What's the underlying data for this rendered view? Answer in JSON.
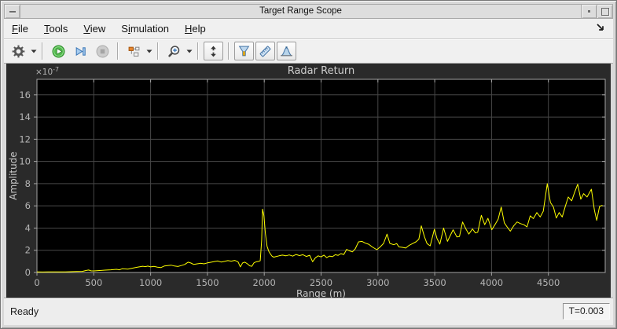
{
  "window": {
    "title": "Target Range Scope",
    "controls": [
      "window-menu",
      "minimize",
      "maximize"
    ]
  },
  "menubar": {
    "items": [
      {
        "label": "File",
        "underline": 0
      },
      {
        "label": "Tools",
        "underline": 0
      },
      {
        "label": "View",
        "underline": 0
      },
      {
        "label": "Simulation",
        "underline": 1
      },
      {
        "label": "Help",
        "underline": 0
      }
    ],
    "dock_icon": "arrow-southeast"
  },
  "toolbar": {
    "buttons": [
      {
        "name": "settings",
        "icon": "gear-icon",
        "dropdown": true,
        "enabled": true
      },
      {
        "name": "run",
        "icon": "run-icon",
        "enabled": true
      },
      {
        "name": "step-forward",
        "icon": "step-forward-icon",
        "enabled": true
      },
      {
        "name": "stop",
        "icon": "stop-icon",
        "enabled": false
      },
      {
        "name": "highlight-simulink-block",
        "icon": "simulink-blocks-icon",
        "dropdown": true,
        "enabled": true
      },
      {
        "name": "zoom",
        "icon": "zoom-in-icon",
        "dropdown": true,
        "enabled": true
      },
      {
        "name": "scale-axes",
        "icon": "scale-y-axis-icon",
        "bordered": true,
        "enabled": true
      },
      {
        "name": "trigger",
        "icon": "trigger-icon",
        "bordered": true,
        "enabled": true
      },
      {
        "name": "cursor-measurements",
        "icon": "ruler-icon",
        "bordered": true,
        "enabled": true
      },
      {
        "name": "peak-finder",
        "icon": "peak-finder-icon",
        "bordered": true,
        "enabled": true
      }
    ]
  },
  "statusbar": {
    "status": "Ready",
    "time": "T=0.003"
  },
  "chart_data": {
    "type": "line",
    "title": "Radar Return",
    "xlabel": "Range (m)",
    "ylabel": "Amplitude",
    "y_scale": {
      "base": "×10",
      "exp": "-7"
    },
    "xlim": [
      0,
      5000
    ],
    "ylim": [
      0,
      17.4
    ],
    "xticks": [
      0,
      500,
      1000,
      1500,
      2000,
      2500,
      3000,
      3500,
      4000,
      4500
    ],
    "yticks": [
      0,
      2,
      4,
      6,
      8,
      10,
      12,
      14,
      16
    ],
    "grid": true,
    "legend": "none",
    "line_color": "#ffff00",
    "plot_bg": "#000000",
    "panel_bg": "#2a2a2a",
    "grid_color": "#474747",
    "tick_label_color": "#b4b4b4",
    "points": [
      [
        0,
        0.05
      ],
      [
        50,
        0.04
      ],
      [
        100,
        0.06
      ],
      [
        150,
        0.05
      ],
      [
        200,
        0.06
      ],
      [
        250,
        0.05
      ],
      [
        300,
        0.07
      ],
      [
        350,
        0.09
      ],
      [
        400,
        0.1
      ],
      [
        430,
        0.18
      ],
      [
        455,
        0.22
      ],
      [
        475,
        0.15
      ],
      [
        500,
        0.14
      ],
      [
        550,
        0.18
      ],
      [
        600,
        0.21
      ],
      [
        650,
        0.24
      ],
      [
        700,
        0.28
      ],
      [
        725,
        0.24
      ],
      [
        750,
        0.33
      ],
      [
        800,
        0.3
      ],
      [
        850,
        0.4
      ],
      [
        875,
        0.46
      ],
      [
        900,
        0.5
      ],
      [
        930,
        0.56
      ],
      [
        955,
        0.52
      ],
      [
        975,
        0.57
      ],
      [
        1000,
        0.5
      ],
      [
        1030,
        0.55
      ],
      [
        1060,
        0.48
      ],
      [
        1090,
        0.44
      ],
      [
        1120,
        0.58
      ],
      [
        1150,
        0.62
      ],
      [
        1180,
        0.66
      ],
      [
        1210,
        0.58
      ],
      [
        1240,
        0.54
      ],
      [
        1270,
        0.62
      ],
      [
        1300,
        0.72
      ],
      [
        1330,
        0.93
      ],
      [
        1355,
        0.85
      ],
      [
        1380,
        0.72
      ],
      [
        1410,
        0.78
      ],
      [
        1440,
        0.83
      ],
      [
        1470,
        0.78
      ],
      [
        1500,
        0.86
      ],
      [
        1530,
        0.92
      ],
      [
        1560,
        0.98
      ],
      [
        1590,
        1.03
      ],
      [
        1620,
        0.94
      ],
      [
        1650,
        1.0
      ],
      [
        1680,
        1.07
      ],
      [
        1710,
        1.02
      ],
      [
        1740,
        1.09
      ],
      [
        1770,
        0.95
      ],
      [
        1790,
        0.5
      ],
      [
        1810,
        0.86
      ],
      [
        1830,
        0.93
      ],
      [
        1852,
        0.78
      ],
      [
        1872,
        0.6
      ],
      [
        1890,
        0.55
      ],
      [
        1910,
        0.88
      ],
      [
        1930,
        0.96
      ],
      [
        1950,
        1.0
      ],
      [
        1965,
        1.06
      ],
      [
        1977,
        2.9
      ],
      [
        1985,
        5.7
      ],
      [
        1997,
        5.1
      ],
      [
        2010,
        3.55
      ],
      [
        2025,
        2.35
      ],
      [
        2040,
        1.9
      ],
      [
        2055,
        1.65
      ],
      [
        2070,
        1.45
      ],
      [
        2085,
        1.38
      ],
      [
        2100,
        1.42
      ],
      [
        2130,
        1.5
      ],
      [
        2160,
        1.56
      ],
      [
        2190,
        1.5
      ],
      [
        2220,
        1.58
      ],
      [
        2250,
        1.47
      ],
      [
        2280,
        1.62
      ],
      [
        2310,
        1.52
      ],
      [
        2340,
        1.6
      ],
      [
        2370,
        1.44
      ],
      [
        2400,
        1.55
      ],
      [
        2425,
        0.97
      ],
      [
        2450,
        1.32
      ],
      [
        2475,
        1.5
      ],
      [
        2500,
        1.4
      ],
      [
        2525,
        1.56
      ],
      [
        2550,
        1.34
      ],
      [
        2575,
        1.48
      ],
      [
        2600,
        1.42
      ],
      [
        2625,
        1.6
      ],
      [
        2650,
        1.54
      ],
      [
        2675,
        1.7
      ],
      [
        2700,
        1.62
      ],
      [
        2725,
        2.08
      ],
      [
        2750,
        1.95
      ],
      [
        2775,
        1.85
      ],
      [
        2800,
        2.12
      ],
      [
        2830,
        2.76
      ],
      [
        2860,
        2.8
      ],
      [
        2890,
        2.64
      ],
      [
        2920,
        2.54
      ],
      [
        2950,
        2.3
      ],
      [
        2990,
        2.05
      ],
      [
        3020,
        2.3
      ],
      [
        3050,
        2.62
      ],
      [
        3080,
        3.45
      ],
      [
        3105,
        2.62
      ],
      [
        3140,
        2.5
      ],
      [
        3165,
        2.6
      ],
      [
        3185,
        2.3
      ],
      [
        3215,
        2.26
      ],
      [
        3245,
        2.2
      ],
      [
        3275,
        2.45
      ],
      [
        3305,
        2.6
      ],
      [
        3335,
        2.76
      ],
      [
        3360,
        3.0
      ],
      [
        3382,
        4.2
      ],
      [
        3410,
        3.2
      ],
      [
        3432,
        2.6
      ],
      [
        3460,
        2.4
      ],
      [
        3497,
        3.9
      ],
      [
        3520,
        3.05
      ],
      [
        3545,
        2.55
      ],
      [
        3578,
        4.0
      ],
      [
        3612,
        2.8
      ],
      [
        3645,
        3.5
      ],
      [
        3662,
        3.85
      ],
      [
        3695,
        3.2
      ],
      [
        3718,
        3.25
      ],
      [
        3745,
        4.55
      ],
      [
        3775,
        3.9
      ],
      [
        3800,
        3.46
      ],
      [
        3832,
        3.92
      ],
      [
        3858,
        3.56
      ],
      [
        3878,
        3.62
      ],
      [
        3910,
        5.15
      ],
      [
        3940,
        4.3
      ],
      [
        3968,
        4.88
      ],
      [
        4002,
        3.85
      ],
      [
        4030,
        4.3
      ],
      [
        4058,
        4.8
      ],
      [
        4085,
        5.9
      ],
      [
        4112,
        4.48
      ],
      [
        4140,
        4.06
      ],
      [
        4165,
        3.72
      ],
      [
        4195,
        4.2
      ],
      [
        4225,
        4.55
      ],
      [
        4255,
        4.4
      ],
      [
        4285,
        4.3
      ],
      [
        4312,
        4.1
      ],
      [
        4340,
        5.1
      ],
      [
        4368,
        4.85
      ],
      [
        4398,
        5.4
      ],
      [
        4428,
        5.0
      ],
      [
        4455,
        5.52
      ],
      [
        4490,
        8.0
      ],
      [
        4518,
        6.3
      ],
      [
        4545,
        5.88
      ],
      [
        4570,
        4.9
      ],
      [
        4595,
        5.4
      ],
      [
        4622,
        5.0
      ],
      [
        4650,
        6.0
      ],
      [
        4675,
        6.8
      ],
      [
        4705,
        6.45
      ],
      [
        4730,
        7.2
      ],
      [
        4758,
        7.95
      ],
      [
        4785,
        6.6
      ],
      [
        4810,
        7.1
      ],
      [
        4840,
        6.8
      ],
      [
        4878,
        7.5
      ],
      [
        4905,
        5.6
      ],
      [
        4925,
        4.7
      ],
      [
        4950,
        5.95
      ],
      [
        4975,
        6.05
      ]
    ]
  }
}
